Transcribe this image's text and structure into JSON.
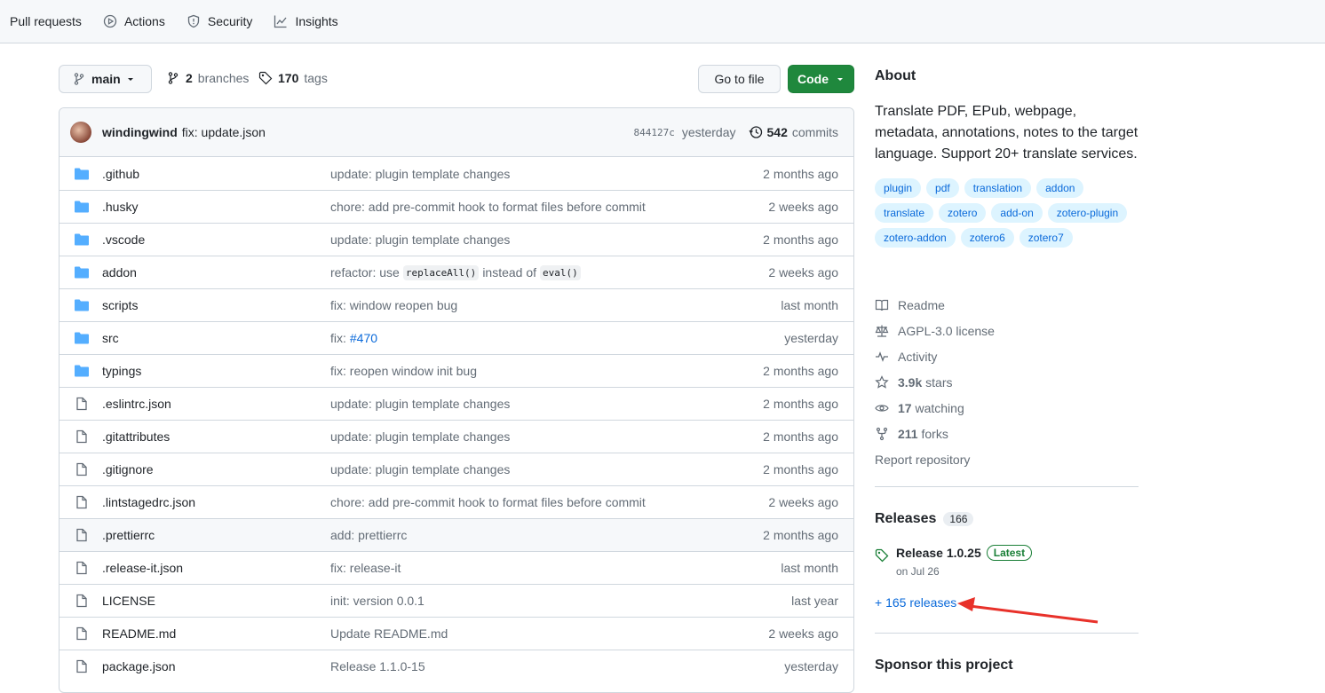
{
  "topnav": {
    "tabs": [
      {
        "label": "Pull requests",
        "icon": "pull-request-icon"
      },
      {
        "label": "Actions",
        "icon": "play-icon"
      },
      {
        "label": "Security",
        "icon": "shield-icon"
      },
      {
        "label": "Insights",
        "icon": "graph-icon"
      }
    ]
  },
  "repo_bar": {
    "branch": "main",
    "branches_count": "2",
    "branches_label": "branches",
    "tags_count": "170",
    "tags_label": "tags",
    "goto_file": "Go to file",
    "code": "Code"
  },
  "latest_commit": {
    "author": "windingwind",
    "message": "fix: update.json",
    "sha": "844127c",
    "time": "yesterday",
    "commits_count": "542",
    "commits_label": "commits"
  },
  "files": [
    {
      "name": ".github",
      "type": "dir",
      "message": "update: plugin template changes",
      "time": "2 months ago"
    },
    {
      "name": ".husky",
      "type": "dir",
      "message": "chore: add pre-commit hook to format files before commit",
      "time": "2 weeks ago"
    },
    {
      "name": ".vscode",
      "type": "dir",
      "message": "update: plugin template changes",
      "time": "2 months ago"
    },
    {
      "name": "addon",
      "type": "dir",
      "message_parts": [
        "refactor: use",
        "replaceAll()",
        "instead of",
        "eval()"
      ],
      "time": "2 weeks ago"
    },
    {
      "name": "scripts",
      "type": "dir",
      "message": "fix: window reopen bug",
      "time": "last month"
    },
    {
      "name": "src",
      "type": "dir",
      "message_prefix": "fix:",
      "message_link": "#470",
      "time": "yesterday"
    },
    {
      "name": "typings",
      "type": "dir",
      "message": "fix: reopen window init bug",
      "time": "2 months ago"
    },
    {
      "name": ".eslintrc.json",
      "type": "file",
      "message": "update: plugin template changes",
      "time": "2 months ago"
    },
    {
      "name": ".gitattributes",
      "type": "file",
      "message": "update: plugin template changes",
      "time": "2 months ago"
    },
    {
      "name": ".gitignore",
      "type": "file",
      "message": "update: plugin template changes",
      "time": "2 months ago"
    },
    {
      "name": ".lintstagedrc.json",
      "type": "file",
      "message": "chore: add pre-commit hook to format files before commit",
      "time": "2 weeks ago"
    },
    {
      "name": ".prettierrc",
      "type": "file",
      "message": "add: prettierrc",
      "time": "2 months ago"
    },
    {
      "name": ".release-it.json",
      "type": "file",
      "message": "fix: release-it",
      "time": "last month"
    },
    {
      "name": "LICENSE",
      "type": "file",
      "message": "init: version 0.0.1",
      "time": "last year"
    },
    {
      "name": "README.md",
      "type": "file",
      "message": "Update README.md",
      "time": "2 weeks ago"
    },
    {
      "name": "package.json",
      "type": "file",
      "message": "Release 1.1.0-15",
      "time": "yesterday"
    }
  ],
  "about": {
    "heading": "About",
    "description": "Translate PDF, EPub, webpage, metadata, annotations, notes to the target language. Support 20+ translate services.",
    "topics": [
      "plugin",
      "pdf",
      "translation",
      "addon",
      "translate",
      "zotero",
      "add-on",
      "zotero-plugin",
      "zotero-addon",
      "zotero6",
      "zotero7"
    ],
    "links": [
      {
        "icon": "book-icon",
        "label": "Readme"
      },
      {
        "icon": "law-icon",
        "label": "AGPL-3.0 license"
      },
      {
        "icon": "pulse-icon",
        "label": "Activity"
      },
      {
        "icon": "star-icon",
        "count": "3.9k",
        "label": "stars"
      },
      {
        "icon": "eye-icon",
        "count": "17",
        "label": "watching"
      },
      {
        "icon": "fork-icon",
        "count": "211",
        "label": "forks"
      },
      {
        "icon": "",
        "label": "Report repository"
      }
    ]
  },
  "releases": {
    "heading": "Releases",
    "count": "166",
    "latest_title": "Release 1.0.25",
    "latest_badge": "Latest",
    "latest_date": "on Jul 26",
    "more_link": "+ 165 releases"
  },
  "sponsor": {
    "heading": "Sponsor this project"
  },
  "colors": {
    "accent": "#0969da",
    "green": "#1f883d",
    "annotation_arrow": "#e8312a",
    "folder": "#54aeff"
  }
}
